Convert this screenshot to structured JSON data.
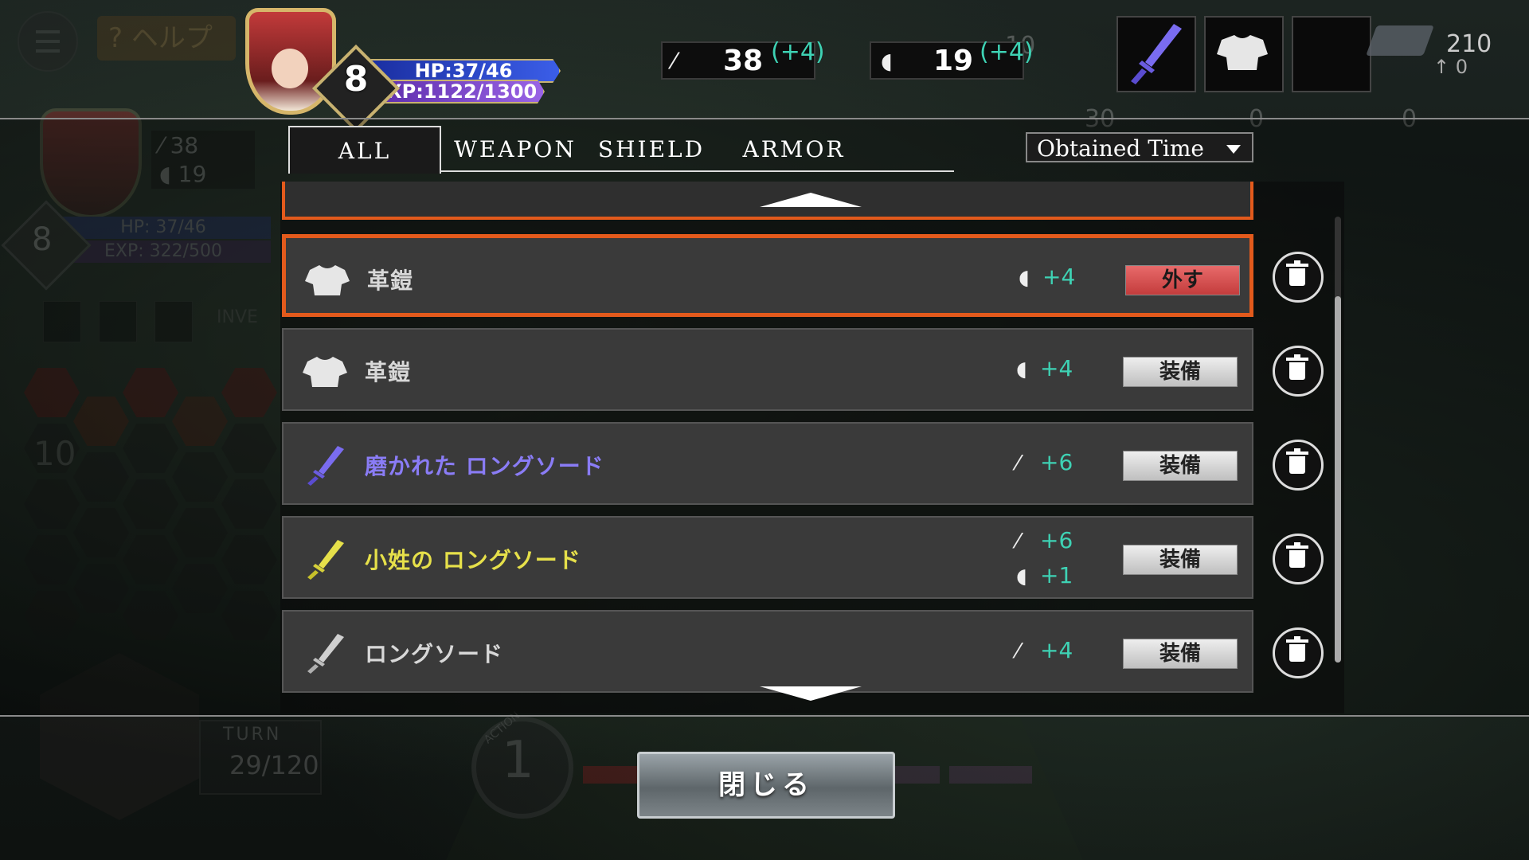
{
  "background": {
    "help_label": "? ヘルプ",
    "mini_attack": "38",
    "mini_defense": "19",
    "mini_hp": "HP: 37/46",
    "mini_exp": "EXP: 322/500",
    "mini_level": "8",
    "inventory_label": "INVE",
    "hex_count": "10",
    "turn_label": "TURN",
    "turn_value": "29/120",
    "action_label": "ACTION",
    "action_value": "1",
    "resource_numbers": [
      "10",
      "0",
      "0",
      "30",
      "0",
      "0"
    ]
  },
  "hud": {
    "level": "8",
    "hp": "HP:37/46",
    "exp": "EXP:1122/1300",
    "attack": "38",
    "attack_bonus": "(+4)",
    "defense": "19",
    "defense_bonus": "(+4)",
    "ingot_count": "210",
    "ingot_sub": "0"
  },
  "tabs": [
    {
      "label": "ALL",
      "active": true
    },
    {
      "label": "WEAPON",
      "active": false
    },
    {
      "label": "SHIELD",
      "active": false
    },
    {
      "label": "ARMOR",
      "active": false
    }
  ],
  "sort": {
    "label": "Obtained Time"
  },
  "items": [
    {
      "icon": "armor-icon",
      "name": "革鎧",
      "name_color": "#d8d8d8",
      "stats": [
        {
          "icon": "shield",
          "value": "+4"
        }
      ],
      "button": "外す",
      "equipped": true
    },
    {
      "icon": "armor-icon",
      "name": "革鎧",
      "name_color": "#d8d8d8",
      "stats": [
        {
          "icon": "shield",
          "value": "+4"
        }
      ],
      "button": "装備",
      "equipped": false
    },
    {
      "icon": "sword-icon",
      "icon_color": "#7a6cf0",
      "name": "磨かれた ロングソード",
      "name_color": "#8a7cf6",
      "stats": [
        {
          "icon": "sword",
          "value": "+6"
        }
      ],
      "button": "装備",
      "equipped": false
    },
    {
      "icon": "sword-icon",
      "icon_color": "#e6e04a",
      "name": "小姓の ロングソード",
      "name_color": "#e6e04a",
      "stats": [
        {
          "icon": "sword",
          "value": "+6"
        },
        {
          "icon": "shield",
          "value": "+1"
        }
      ],
      "button": "装備",
      "equipped": false
    },
    {
      "icon": "sword-icon",
      "icon_color": "#cfcfcf",
      "name": "ロングソード",
      "name_color": "#d8d8d8",
      "stats": [
        {
          "icon": "sword",
          "value": "+4"
        }
      ],
      "button": "装備",
      "equipped": false
    }
  ],
  "close_button": "閉じる",
  "colors": {
    "accent_orange": "#e35a1c",
    "stat_teal": "#3ed2b4",
    "unequip_red": "#d94848"
  }
}
